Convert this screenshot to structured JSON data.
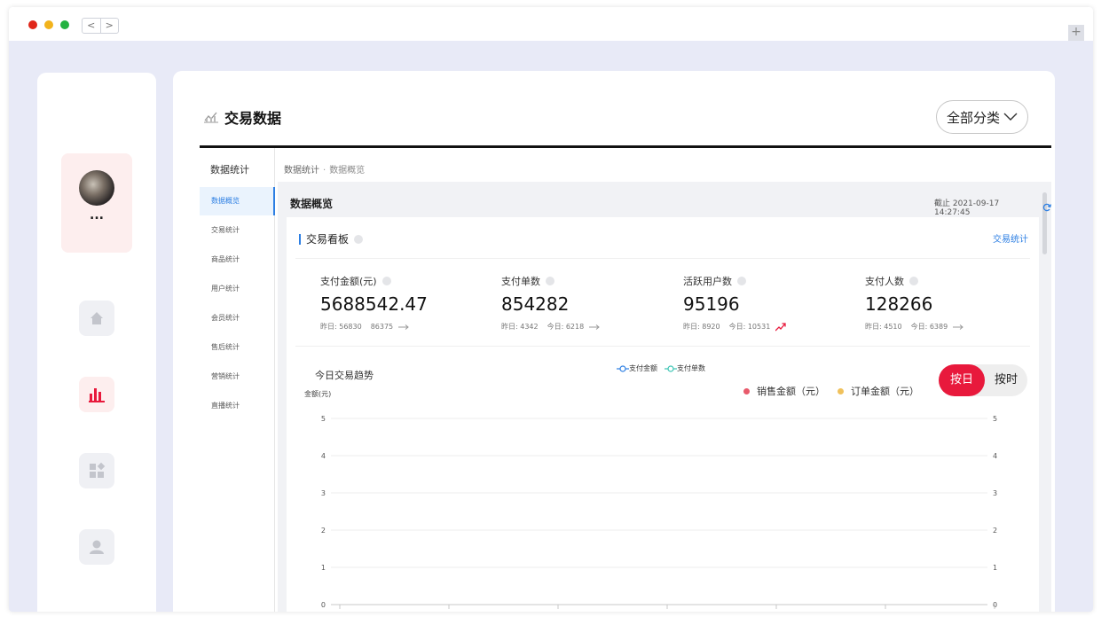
{
  "window": {
    "traffic_colors": [
      "#e0271a",
      "#f2b31c",
      "#23b240"
    ],
    "nav_back": "<",
    "nav_forward": ">",
    "add_tab": "+"
  },
  "user": {
    "name": "..."
  },
  "sidebar_nav": [
    {
      "icon": "home-icon",
      "active": false
    },
    {
      "icon": "bar-chart-icon",
      "active": true
    },
    {
      "icon": "apps-icon",
      "active": false
    },
    {
      "icon": "user-icon",
      "active": false
    }
  ],
  "page": {
    "title": "交易数据",
    "category_button": "全部分类"
  },
  "subnav": {
    "title": "数据统计",
    "items": [
      "数据概览",
      "交易统计",
      "商品统计",
      "用户统计",
      "会员统计",
      "售后统计",
      "营销统计",
      "直播统计"
    ],
    "active_index": 0
  },
  "breadcrumb": {
    "parent": "数据统计",
    "separator": "·",
    "current": "数据概览"
  },
  "overview": {
    "title": "数据概览",
    "as_of": "截止 2021-09-17 14:27:45"
  },
  "board": {
    "title": "交易看板",
    "link": "交易统计",
    "metrics": [
      {
        "label": "支付金额(元)",
        "value": "5688542.47",
        "yesterday": "昨日: 56830",
        "today": "86375",
        "trend": "flat"
      },
      {
        "label": "支付单数",
        "value": "854282",
        "yesterday": "昨日: 4342",
        "today": "今日: 6218",
        "trend": "flat"
      },
      {
        "label": "活跃用户数",
        "value": "95196",
        "yesterday": "昨日: 8920",
        "today": "今日: 10531",
        "trend": "up"
      },
      {
        "label": "支付人数",
        "value": "128266",
        "yesterday": "昨日: 4510",
        "today": "今日: 6389",
        "trend": "flat"
      }
    ]
  },
  "trend": {
    "title": "今日交易趋势",
    "legend_top": [
      "支付金额",
      "支付单数"
    ],
    "legend_bottom": [
      {
        "label": "销售金额（元）",
        "color": "#e85a6b"
      },
      {
        "label": "订单金额（元）",
        "color": "#f0c15c"
      }
    ],
    "toggle_on": "按日",
    "toggle_off": "按时",
    "y_unit": "金额(元)"
  },
  "chart_data": {
    "type": "line",
    "title": "今日交易趋势",
    "ylabel": "金额(元)",
    "ylim": [
      0,
      5
    ],
    "yticks": [
      0,
      1,
      2,
      3,
      4,
      5
    ],
    "y2ticks": [
      0,
      1,
      2,
      3,
      4,
      5
    ],
    "series": [
      {
        "name": "支付金额",
        "values": []
      },
      {
        "name": "支付单数",
        "values": []
      }
    ]
  }
}
